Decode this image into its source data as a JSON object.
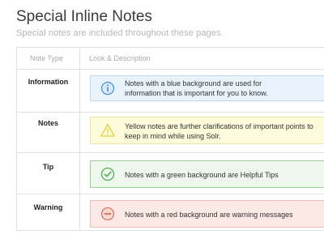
{
  "page": {
    "title": "Special Inline Notes",
    "subtitle": "Special notes are included throughout these pages."
  },
  "table": {
    "headers": {
      "type": "Note Type",
      "description": "Look & Description"
    },
    "rows": [
      {
        "type": "Information",
        "style": "info",
        "icon": "info-icon",
        "lines": [
          "Notes with a blue background are used for",
          "information that is important for you to know."
        ]
      },
      {
        "type": "Notes",
        "style": "notes",
        "icon": "warning-triangle-icon",
        "lines": [
          "Yellow notes are further clarifications of important points to",
          "keep in mind while using Solr."
        ]
      },
      {
        "type": "Tip",
        "style": "tip",
        "icon": "check-circle-icon",
        "lines": [
          "Notes with a green background are Helpful Tips"
        ]
      },
      {
        "type": "Warning",
        "style": "warning",
        "icon": "minus-circle-icon",
        "lines": [
          "Notes with a red background are warning messages"
        ]
      }
    ]
  },
  "colors": {
    "info_background": "#e8f3fb",
    "info_icon": "#4a8ed1",
    "notes_background": "#fdfbd9",
    "notes_icon": "#e4cf3e",
    "tip_background": "#eef7ec",
    "tip_icon": "#4caf50",
    "warning_background": "#fbe9e6",
    "warning_icon": "#d47a6a"
  }
}
